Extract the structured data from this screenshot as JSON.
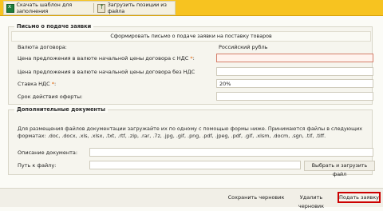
{
  "toolbar": {
    "download_template": "Скачать шаблон для заполнения",
    "upload_positions": "Загрузить позиции из файла"
  },
  "letter_section": {
    "title": "Письмо о подаче заявки",
    "generate_button": "Сформировать письмо о подаче заявки на поставку товаров",
    "currency_label": "Валюта договора:",
    "currency_value": "Российский рубль",
    "price_with_vat_label": "Цена предложения в валюте начальной цены договора с НДС",
    "price_with_vat_value": "",
    "price_without_vat_label": "Цена предложения в валюте начальной цены договора без НДС",
    "price_without_vat_value": "",
    "vat_rate_label": "Ставка НДС",
    "vat_rate_value": "20%",
    "offer_validity_label": "Срок действия оферты:",
    "offer_validity_value": "",
    "required_mark": "*",
    "colon": ":"
  },
  "docs_section": {
    "title": "Дополнительные документы",
    "note": "Для размещения файлов документации загружайте их по одному с помощью формы ниже. Принимаются файлы в следующих форматах: .doc, .docx, .xls, .xlsx, .txt, .rtf, .zip, .rar, .7z, .jpg, .gif, .png, .pdf, .jpeg, .pdf, .gif, .xlsm, .docm, .sgn, .tif, .tiff.",
    "description_label": "Описание документа:",
    "description_value": "",
    "file_path_label": "Путь к файлу:",
    "file_path_value": "",
    "choose_upload_button": "Выбрать и загрузить файл"
  },
  "footer": {
    "save_draft": "Сохранить черновик",
    "delete_draft": "Удалить черновик",
    "submit": "Подать заявку"
  },
  "colors": {
    "toolbar_bg": "#f7c320",
    "required_star": "#e06000",
    "submit_border": "#cc0000"
  }
}
